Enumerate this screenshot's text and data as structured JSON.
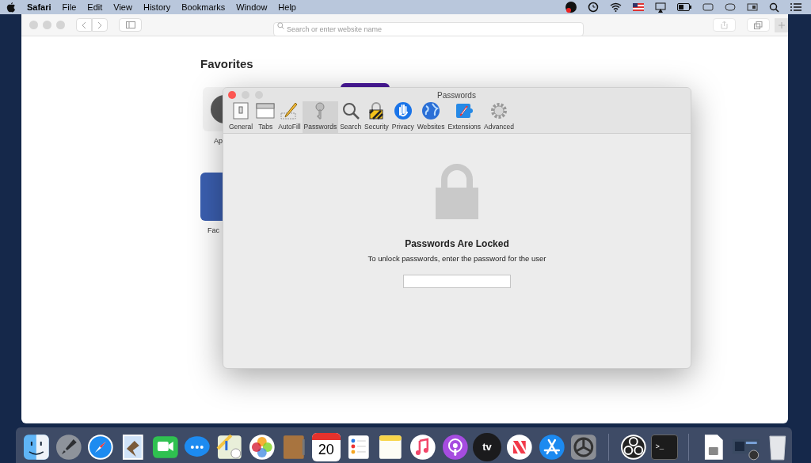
{
  "menu_bar": {
    "app_name": "Safari",
    "menus": [
      "File",
      "Edit",
      "View",
      "History",
      "Bookmarks",
      "Window",
      "Help"
    ]
  },
  "browser": {
    "address_placeholder": "Search or enter website name",
    "heading": "Favorites",
    "favorites": [
      {
        "kind": "grey",
        "label": "Ap"
      },
      {
        "kind": "purple"
      },
      {
        "kind": "blue",
        "label": "Fac"
      }
    ]
  },
  "preferences": {
    "title": "Passwords",
    "tabs": [
      {
        "kind": "general",
        "label": "General",
        "selected": false
      },
      {
        "kind": "tabs",
        "label": "Tabs",
        "selected": false
      },
      {
        "kind": "autofill",
        "label": "AutoFill",
        "selected": false
      },
      {
        "kind": "passwords",
        "label": "Passwords",
        "selected": true
      },
      {
        "kind": "search",
        "label": "Search",
        "selected": false
      },
      {
        "kind": "security",
        "label": "Security",
        "selected": false
      },
      {
        "kind": "privacy",
        "label": "Privacy",
        "selected": false
      },
      {
        "kind": "websites",
        "label": "Websites",
        "selected": false
      },
      {
        "kind": "extensions",
        "label": "Extensions",
        "selected": false
      },
      {
        "kind": "advanced",
        "label": "Advanced",
        "selected": false
      }
    ],
    "locked_title": "Passwords Are Locked",
    "locked_message": "To unlock passwords, enter the password for the user"
  },
  "dock": [
    {
      "kind": "finder"
    },
    {
      "kind": "launchpad"
    },
    {
      "kind": "safari"
    },
    {
      "kind": "mail"
    },
    {
      "kind": "facetime"
    },
    {
      "kind": "messages"
    },
    {
      "kind": "maps"
    },
    {
      "kind": "photos"
    },
    {
      "kind": "contacts"
    },
    {
      "kind": "calendar",
      "label": "20"
    },
    {
      "kind": "reminders"
    },
    {
      "kind": "notes"
    },
    {
      "kind": "music"
    },
    {
      "kind": "podcasts"
    },
    {
      "kind": "tv",
      "label": "tv"
    },
    {
      "kind": "news"
    },
    {
      "kind": "appstore"
    },
    {
      "kind": "settings"
    },
    {
      "kind": "separator"
    },
    {
      "kind": "obs"
    },
    {
      "kind": "terminal",
      "label": ">_"
    },
    {
      "kind": "separator"
    },
    {
      "kind": "file"
    },
    {
      "kind": "screenshot"
    },
    {
      "kind": "trash"
    }
  ]
}
